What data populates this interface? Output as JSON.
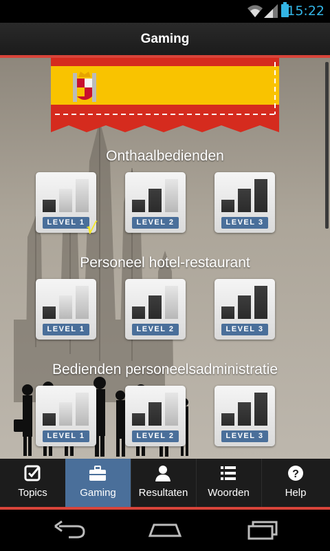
{
  "status_bar": {
    "time": "15:22"
  },
  "action_bar": {
    "title": "Gaming"
  },
  "sections": [
    {
      "title": "Onthaalbedienden",
      "levels": [
        "LEVEL 1",
        "LEVEL 2",
        "LEVEL 3"
      ],
      "completed_level": 1
    },
    {
      "title": "Personeel hotel-restaurant",
      "levels": [
        "LEVEL 1",
        "LEVEL 2",
        "LEVEL 3"
      ]
    },
    {
      "title": "Bedienden personeelsadministratie",
      "levels": [
        "LEVEL 1",
        "LEVEL 2",
        "LEVEL 3"
      ]
    }
  ],
  "check_mark": "√",
  "tabs": [
    {
      "label": "Topics",
      "icon": "checkbox-icon"
    },
    {
      "label": "Gaming",
      "icon": "briefcase-icon",
      "active": true
    },
    {
      "label": "Resultaten",
      "icon": "person-icon"
    },
    {
      "label": "Woorden",
      "icon": "list-icon"
    },
    {
      "label": "Help",
      "icon": "help-icon"
    }
  ],
  "colors": {
    "accent_red": "#d8443a",
    "tab_active": "#4a6f9a",
    "level_badge": "#4a6f9a",
    "check": "#f5e820",
    "status_blue": "#33b5e5"
  }
}
